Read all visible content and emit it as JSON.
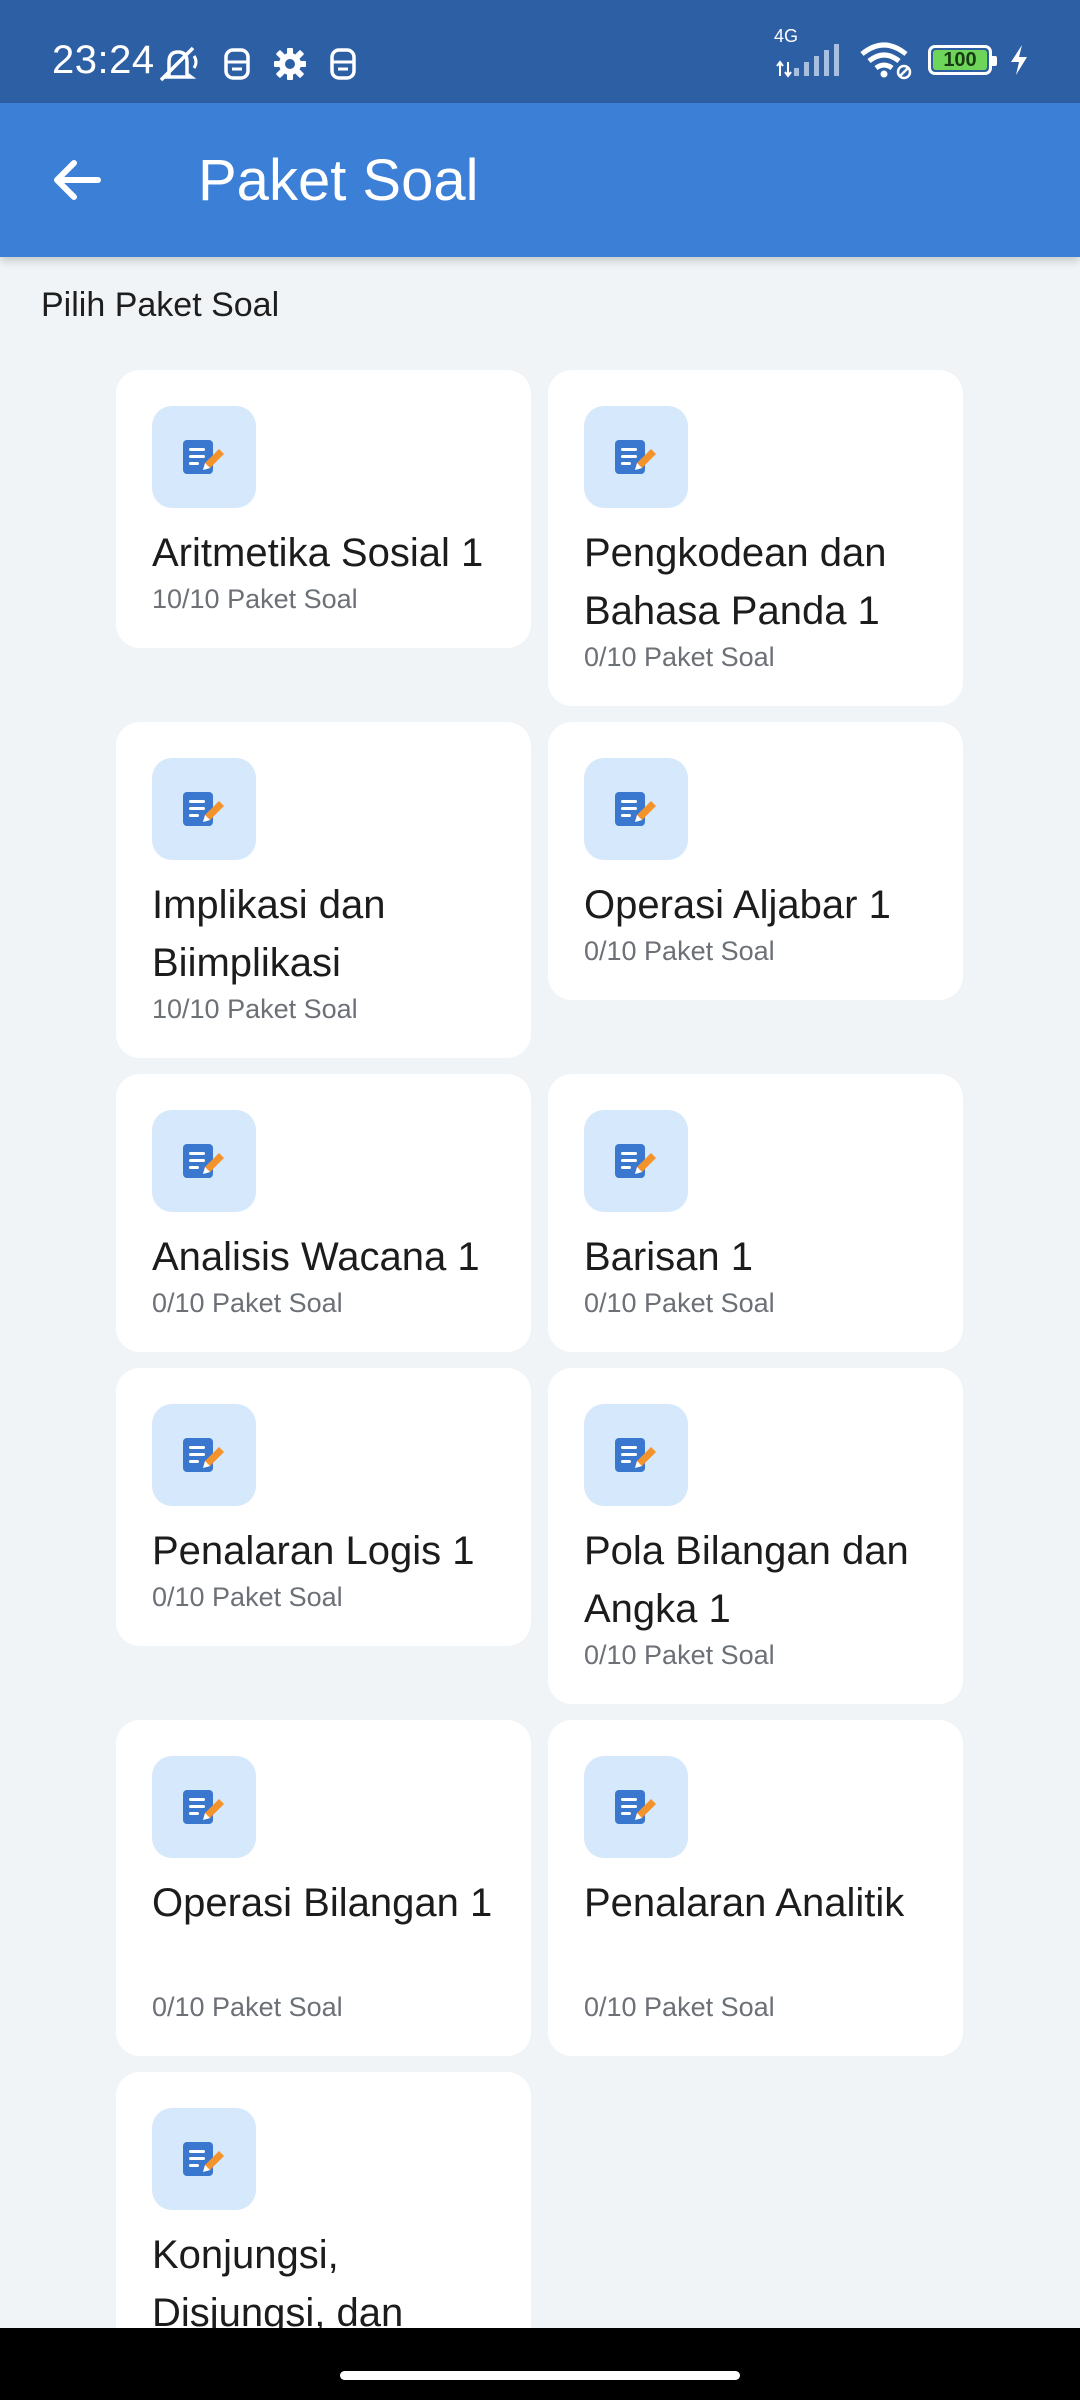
{
  "status_bar": {
    "time": "23:24",
    "network": "4G",
    "battery": "100",
    "icons": [
      "silent-icon",
      "face-icon",
      "gear-icon",
      "face-icon",
      "signal-icon",
      "wifi-icon",
      "battery-icon",
      "charging-icon"
    ]
  },
  "app_bar": {
    "title": "Paket Soal",
    "back_icon": "arrow-left-icon"
  },
  "section_label": "Pilih Paket Soal",
  "colors": {
    "status_bar": "#2d5fa4",
    "app_bar": "#3c7fd7",
    "background": "#f1f4f6",
    "icon_bg": "#d6e8fb",
    "icon_primary": "#3a78d0",
    "icon_accent": "#f2932b"
  },
  "packages": [
    {
      "title": "Aritmetika Sosial 1",
      "subtitle": "10/10 Paket Soal"
    },
    {
      "title": "Pengkodean dan Bahasa Panda 1",
      "subtitle": "0/10 Paket Soal"
    },
    {
      "title": "Implikasi dan Biimplikasi",
      "subtitle": "10/10 Paket Soal"
    },
    {
      "title": "Operasi Aljabar 1",
      "subtitle": "0/10 Paket Soal"
    },
    {
      "title": "Analisis Wacana 1",
      "subtitle": "0/10 Paket Soal"
    },
    {
      "title": "Barisan 1",
      "subtitle": "0/10 Paket Soal"
    },
    {
      "title": "Penalaran Logis 1",
      "subtitle": "0/10 Paket Soal"
    },
    {
      "title": "Pola Bilangan dan Angka 1",
      "subtitle": "0/10 Paket Soal"
    },
    {
      "title": "Operasi Bilangan 1",
      "subtitle": "0/10 Paket Soal"
    },
    {
      "title": "Penalaran Analitik",
      "subtitle": "0/10 Paket Soal"
    },
    {
      "title": "Konjungsi, Disjungsi, dan",
      "subtitle": ""
    }
  ]
}
